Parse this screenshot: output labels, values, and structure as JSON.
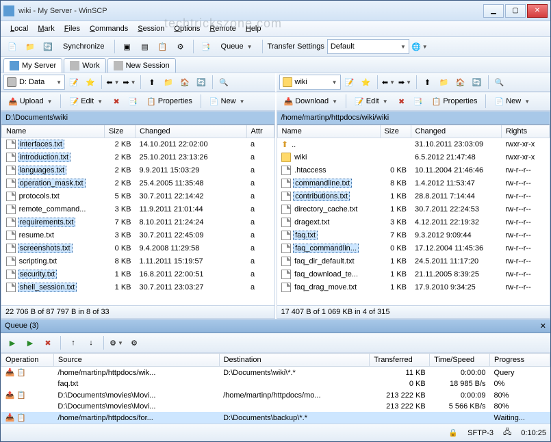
{
  "window": {
    "title": "wiki - My Server - WinSCP"
  },
  "watermark": "techtrickszone.com",
  "menu": [
    "Local",
    "Mark",
    "Files",
    "Commands",
    "Session",
    "Options",
    "Remote",
    "Help"
  ],
  "toolbar1": {
    "sync": "Synchronize",
    "queue": "Queue",
    "transfer_label": "Transfer Settings",
    "transfer_value": "Default"
  },
  "tabs": [
    {
      "label": "My Server",
      "active": true
    },
    {
      "label": "Work",
      "active": false
    },
    {
      "label": "New Session",
      "active": false
    }
  ],
  "local": {
    "drive": "D: Data",
    "actions": {
      "upload": "Upload",
      "edit": "Edit",
      "props": "Properties",
      "new": "New"
    },
    "path": "D:\\Documents\\wiki",
    "cols": [
      "Name",
      "Size",
      "Changed",
      "Attr"
    ],
    "rows": [
      {
        "n": "interfaces.txt",
        "s": "2 KB",
        "c": "14.10.2011  22:02:00",
        "a": "a",
        "sel": true
      },
      {
        "n": "introduction.txt",
        "s": "2 KB",
        "c": "25.10.2011  23:13:26",
        "a": "a",
        "sel": true
      },
      {
        "n": "languages.txt",
        "s": "2 KB",
        "c": "9.9.2011  15:03:29",
        "a": "a",
        "sel": true
      },
      {
        "n": "operation_mask.txt",
        "s": "2 KB",
        "c": "25.4.2005  11:35:48",
        "a": "a",
        "sel": true
      },
      {
        "n": "protocols.txt",
        "s": "5 KB",
        "c": "30.7.2011  22:14:42",
        "a": "a",
        "sel": false
      },
      {
        "n": "remote_command...",
        "s": "3 KB",
        "c": "11.9.2011  21:01:44",
        "a": "a",
        "sel": false
      },
      {
        "n": "requirements.txt",
        "s": "7 KB",
        "c": "8.10.2011  21:24:24",
        "a": "a",
        "sel": true
      },
      {
        "n": "resume.txt",
        "s": "3 KB",
        "c": "30.7.2011  22:45:09",
        "a": "a",
        "sel": false
      },
      {
        "n": "screenshots.txt",
        "s": "0 KB",
        "c": "9.4.2008  11:29:58",
        "a": "a",
        "sel": true
      },
      {
        "n": "scripting.txt",
        "s": "8 KB",
        "c": "1.11.2011  15:19:57",
        "a": "a",
        "sel": false
      },
      {
        "n": "security.txt",
        "s": "1 KB",
        "c": "16.8.2011  22:00:51",
        "a": "a",
        "sel": true
      },
      {
        "n": "shell_session.txt",
        "s": "1 KB",
        "c": "30.7.2011  23:03:27",
        "a": "a",
        "sel": true
      }
    ],
    "status": "22 706 B of 87 797 B in 8 of 33"
  },
  "remote": {
    "drive": "wiki",
    "actions": {
      "download": "Download",
      "edit": "Edit",
      "props": "Properties",
      "new": "New"
    },
    "path": "/home/martinp/httpdocs/wiki/wiki",
    "cols": [
      "Name",
      "Size",
      "Changed",
      "Rights"
    ],
    "rows": [
      {
        "n": "..",
        "s": "",
        "c": "31.10.2011 23:03:09",
        "r": "rwxr-xr-x",
        "icon": "up"
      },
      {
        "n": "wiki",
        "s": "",
        "c": "6.5.2012 21:47:48",
        "r": "rwxr-xr-x",
        "icon": "folder"
      },
      {
        "n": ".htaccess",
        "s": "0 KB",
        "c": "10.11.2004 21:46:46",
        "r": "rw-r--r--"
      },
      {
        "n": "commandline.txt",
        "s": "8 KB",
        "c": "1.4.2012 11:53:47",
        "r": "rw-r--r--",
        "sel": true
      },
      {
        "n": "contributions.txt",
        "s": "1 KB",
        "c": "28.8.2011 7:14:44",
        "r": "rw-r--r--",
        "sel": true
      },
      {
        "n": "directory_cache.txt",
        "s": "1 KB",
        "c": "30.7.2011 22:24:53",
        "r": "rw-r--r--"
      },
      {
        "n": "dragext.txt",
        "s": "3 KB",
        "c": "4.12.2011 22:19:32",
        "r": "rw-r--r--"
      },
      {
        "n": "faq.txt",
        "s": "7 KB",
        "c": "9.3.2012 9:09:44",
        "r": "rw-r--r--",
        "sel": true
      },
      {
        "n": "faq_commandlin...",
        "s": "0 KB",
        "c": "17.12.2004 11:45:36",
        "r": "rw-r--r--",
        "sel": true
      },
      {
        "n": "faq_dir_default.txt",
        "s": "1 KB",
        "c": "24.5.2011 11:17:20",
        "r": "rw-r--r--"
      },
      {
        "n": "faq_download_te...",
        "s": "1 KB",
        "c": "21.11.2005 8:39:25",
        "r": "rw-r--r--"
      },
      {
        "n": "faq_drag_move.txt",
        "s": "1 KB",
        "c": "17.9.2010 9:34:25",
        "r": "rw-r--r--"
      }
    ],
    "status": "17 407 B of 1 069 KB in 4 of 315"
  },
  "queue": {
    "title": "Queue (3)",
    "cols": [
      "Operation",
      "Source",
      "Destination",
      "Transferred",
      "Time/Speed",
      "Progress"
    ],
    "rows": [
      {
        "op": "dl",
        "src": "/home/martinp/httpdocs/wik...",
        "dst": "D:\\Documents\\wiki\\*.*",
        "tx": "11 KB",
        "ts": "0:00:00",
        "pr": "Query"
      },
      {
        "op": "",
        "src": "faq.txt",
        "dst": "",
        "tx": "0 KB",
        "ts": "18 985 B/s",
        "pr": "0%"
      },
      {
        "op": "ul",
        "src": "D:\\Documents\\movies\\Movi...",
        "dst": "/home/martinp/httpdocs/mo...",
        "tx": "213 222 KB",
        "ts": "0:00:09",
        "pr": "80%"
      },
      {
        "op": "",
        "src": "D:\\Documents\\movies\\Movi...",
        "dst": "",
        "tx": "213 222 KB",
        "ts": "5 566 KB/s",
        "pr": "80%"
      },
      {
        "op": "dl",
        "src": "/home/martinp/httpdocs/for...",
        "dst": "D:\\Documents\\backup\\*.*",
        "tx": "",
        "ts": "",
        "pr": "Waiting...",
        "selected": true
      }
    ]
  },
  "bottom": {
    "proto": "SFTP-3",
    "time": "0:10:25"
  }
}
